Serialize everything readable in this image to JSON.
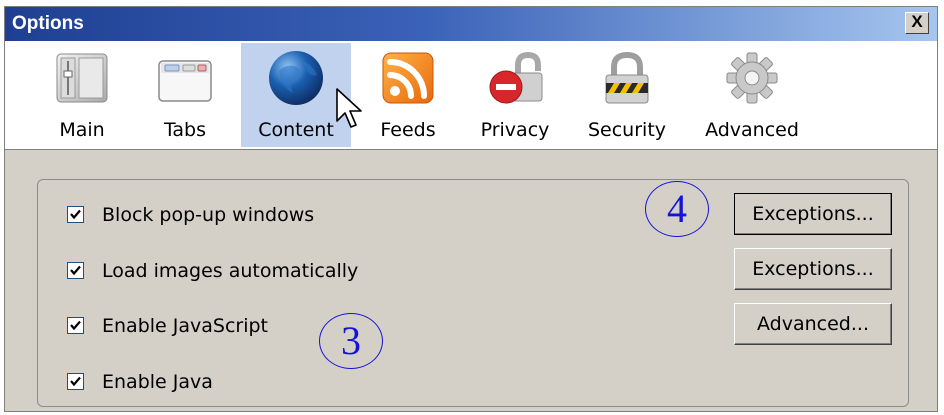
{
  "window": {
    "title": "Options",
    "close_label": "X"
  },
  "tabs": [
    {
      "id": "main",
      "label": "Main",
      "icon": "main-icon"
    },
    {
      "id": "tabs",
      "label": "Tabs",
      "icon": "tabs-icon"
    },
    {
      "id": "content",
      "label": "Content",
      "icon": "globe-icon",
      "selected": true
    },
    {
      "id": "feeds",
      "label": "Feeds",
      "icon": "rss-icon"
    },
    {
      "id": "privacy",
      "label": "Privacy",
      "icon": "padlock-open-icon"
    },
    {
      "id": "security",
      "label": "Security",
      "icon": "padlock-icon"
    },
    {
      "id": "advanced",
      "label": "Advanced",
      "icon": "gear-icon"
    }
  ],
  "options": [
    {
      "label": "Block pop-up windows",
      "checked": true
    },
    {
      "label": "Load images automatically",
      "checked": true
    },
    {
      "label": "Enable JavaScript",
      "checked": true
    },
    {
      "label": "Enable Java",
      "checked": true
    }
  ],
  "buttons": {
    "exceptions_popup": "Exceptions...",
    "exceptions_images": "Exceptions...",
    "advanced_js": "Advanced..."
  },
  "annotations": {
    "three": "3",
    "four": "4"
  },
  "colors": {
    "titlebar_start": "#1f3f92",
    "titlebar_end": "#a6c6ef",
    "selected_tab": "#c1d2ee",
    "dialog_bg": "#d4d0c8",
    "annotation": "#1414d8"
  }
}
